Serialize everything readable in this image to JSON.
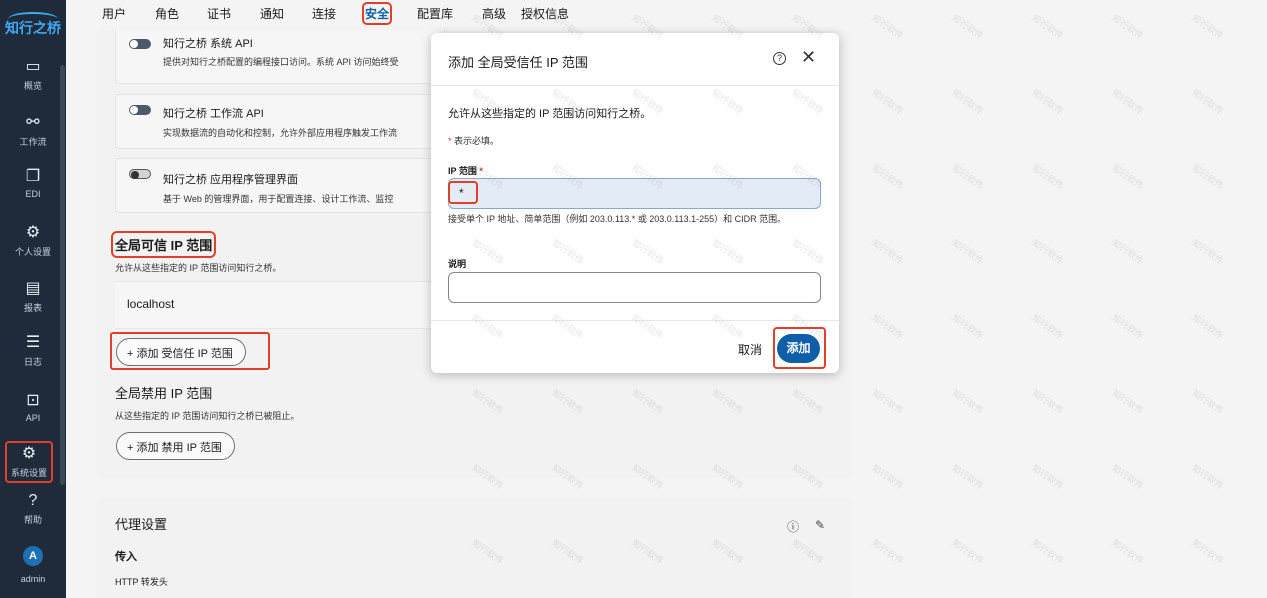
{
  "app": {
    "logo_text": "知行之桥",
    "brand_color": "#3fa9f5",
    "accent_color": "#0f5ea8",
    "highlight_color": "#e0402a"
  },
  "sidebar": {
    "items": [
      {
        "label": "概览",
        "icon": "dashboard-icon"
      },
      {
        "label": "工作流",
        "icon": "workflow-icon"
      },
      {
        "label": "EDI",
        "icon": "edi-icon"
      },
      {
        "label": "个人设置",
        "icon": "personal-settings-icon"
      },
      {
        "label": "报表",
        "icon": "report-icon"
      },
      {
        "label": "日志",
        "icon": "log-icon"
      },
      {
        "label": "API",
        "icon": "api-icon"
      },
      {
        "label": "系统设置",
        "icon": "gear-icon"
      },
      {
        "label": "帮助",
        "icon": "help-icon"
      }
    ],
    "user": {
      "initial": "A",
      "name": "admin"
    }
  },
  "tabs": [
    "用户",
    "角色",
    "证书",
    "通知",
    "连接",
    "安全",
    "配置库",
    "高级",
    "授权信息"
  ],
  "active_tab": "安全",
  "api_rows": [
    {
      "title": "知行之桥 系统 API",
      "desc": "提供对知行之桥配置的编程接口访问。系统 API 访问始终受",
      "enabled": true
    },
    {
      "title": "知行之桥 工作流 API",
      "desc": "实现数据流的自动化和控制，允许外部应用程序触发工作流",
      "enabled": true
    },
    {
      "title": "知行之桥 应用程序管理界面",
      "desc": "基于 Web 的管理界面，用于配置连接、设计工作流、监控",
      "enabled": false
    }
  ],
  "trusted": {
    "title": "全局可信 IP 范围",
    "desc": "允许从这些指定的 IP 范围访问知行之桥。",
    "entries": [
      "localhost"
    ],
    "add_label": "+ 添加 受信任 IP 范围"
  },
  "blocked": {
    "title": "全局禁用 IP 范围",
    "desc": "从这些指定的 IP 范围访问知行之桥已被阻止。",
    "add_label": "+ 添加 禁用 IP 范围"
  },
  "proxy": {
    "title": "代理设置",
    "incoming": "传入",
    "http_header": "HTTP 转发头"
  },
  "modal": {
    "title": "添加 全局受信任 IP 范围",
    "intro": "允许从这些指定的 IP 范围访问知行之桥。",
    "required_note": "表示必填。",
    "required_mark": "*",
    "ip_label": "IP 范围",
    "ip_value": "*",
    "ip_hint": "接受单个 IP 地址、简单范围（例如 203.0.113.* 或 203.0.113.1-255）和 CIDR 范围。",
    "desc_label": "说明",
    "desc_value": "",
    "cancel_label": "取消",
    "add_label": "添加"
  },
  "watermark_text": "知行软件"
}
